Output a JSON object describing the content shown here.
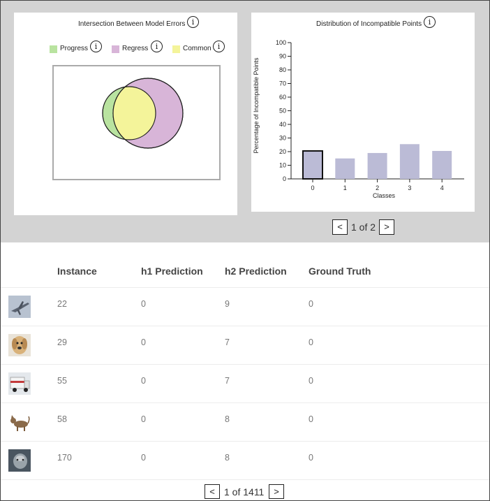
{
  "venn_panel": {
    "title": "Intersection Between Model Errors",
    "info_glyph": "i",
    "legend": [
      {
        "label": "Progress",
        "color": "#b9e3a0"
      },
      {
        "label": "Regress",
        "color": "#d8b5d8"
      },
      {
        "label": "Common",
        "color": "#f4f49a"
      }
    ]
  },
  "chart_panel": {
    "pager": {
      "prev": "<",
      "status": "1 of 2",
      "next": ">"
    }
  },
  "chart_data": {
    "type": "bar",
    "title": "Distribution of Incompatible Points",
    "xlabel": "Classes",
    "ylabel": "Percentage of Incompatible Points",
    "categories": [
      "0",
      "1",
      "2",
      "3",
      "4"
    ],
    "values": [
      20.5,
      15,
      19,
      25.5,
      20.5
    ],
    "ylim": [
      0,
      100
    ],
    "yticks": [
      "0",
      "10",
      "20",
      "30",
      "40",
      "50",
      "60",
      "70",
      "80",
      "90",
      "100"
    ],
    "bar_color": "#bbbbd6",
    "selected_category": "0",
    "grid": false
  },
  "table": {
    "headers": [
      "Instance",
      "h1 Prediction",
      "h2 Prediction",
      "Ground Truth"
    ],
    "rows": [
      {
        "image": "airplane-thumbnail",
        "instance": "22",
        "h1": "0",
        "h2": "9",
        "truth": "0"
      },
      {
        "image": "dog-thumbnail",
        "instance": "29",
        "h1": "0",
        "h2": "7",
        "truth": "0"
      },
      {
        "image": "truck-thumbnail",
        "instance": "55",
        "h1": "0",
        "h2": "7",
        "truth": "0"
      },
      {
        "image": "cat-thumbnail",
        "instance": "58",
        "h1": "0",
        "h2": "8",
        "truth": "0"
      },
      {
        "image": "animal-face-thumbnail",
        "instance": "170",
        "h1": "0",
        "h2": "8",
        "truth": "0"
      }
    ],
    "pager": {
      "prev": "<",
      "status": "1 of 1411",
      "next": ">"
    }
  }
}
